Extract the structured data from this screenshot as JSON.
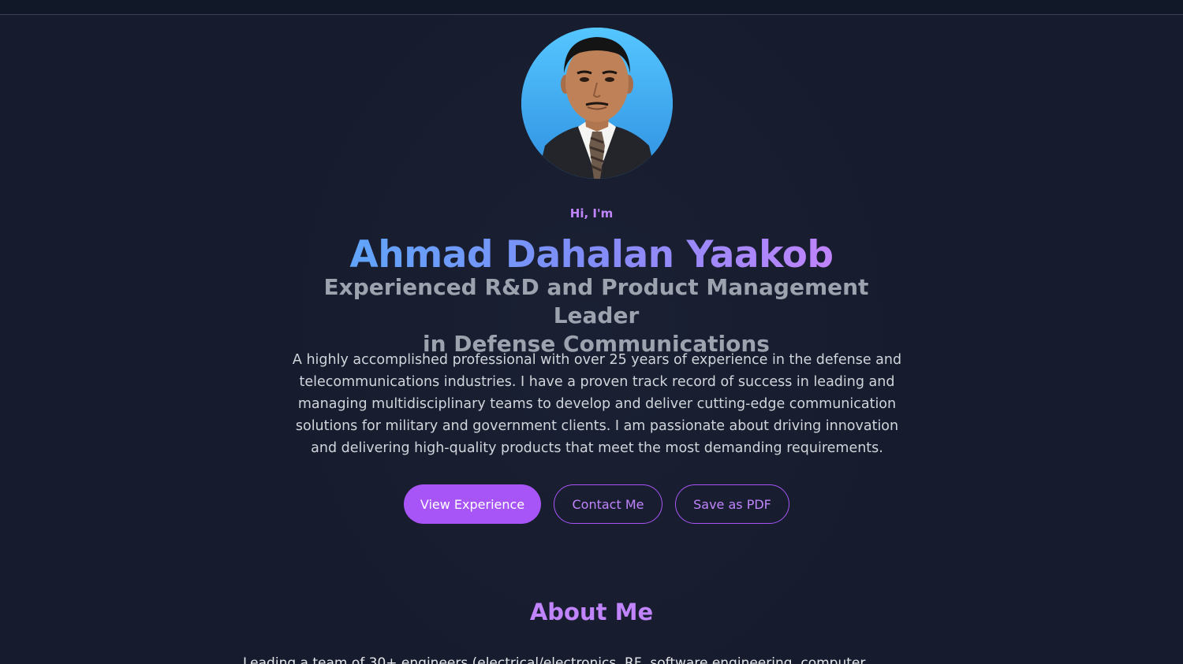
{
  "hero": {
    "greeting": "Hi, I'm",
    "name": "Ahmad Dahalan Yaakob",
    "subtitle_line1": "Experienced R&D and Product Management Leader",
    "subtitle_line2": "in Defense Communications",
    "bio": "A highly accomplished professional with over 25 years of experience in the defense and telecommunications industries. I have a proven track record of success in leading and managing multidisciplinary teams to develop and deliver cutting-edge communication solutions for military and government clients. I am passionate about driving innovation and delivering high-quality products that meet the most demanding requirements."
  },
  "actions": {
    "view_experience": "View Experience",
    "contact_me": "Contact Me",
    "save_pdf": "Save as PDF"
  },
  "about": {
    "title": "About Me",
    "text_preview": "Leading a team of 30+ engineers (electrical/electronics, RF, software engineering, computer"
  },
  "colors": {
    "background": "#161c2d",
    "accent": "#a855f7",
    "accent_light": "#c084fc",
    "name_gradient_start": "#60a5fa",
    "name_gradient_end": "#c084fc"
  },
  "icons": {
    "avatar": "profile-photo"
  }
}
